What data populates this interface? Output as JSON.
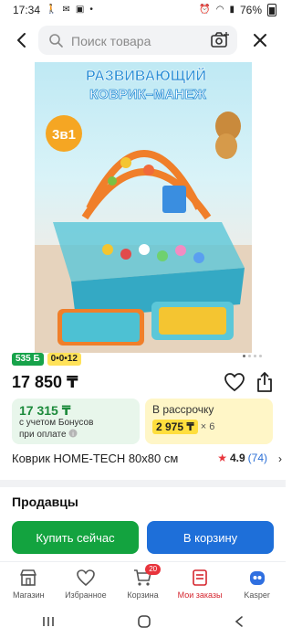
{
  "status_bar": {
    "time": "17:34",
    "battery": "76%"
  },
  "search": {
    "placeholder": "Поиск товара"
  },
  "product": {
    "image_title_line1": "РАЗВИВАЮЩИЙ",
    "image_title_line2": "КОВРИК–МАНЕЖ",
    "image_badge": "3в1",
    "bonus_badge": "535 Б",
    "installment_badge": "0•0•12",
    "price": "17 850 ₸",
    "name": "Коврик HOME-TECH 80x80 см",
    "rating": "4.9",
    "reviews": "(74)"
  },
  "bonus_card": {
    "price": "17 315 ₸",
    "note_line1": "с учетом Бонусов",
    "note_line2": "при оплате"
  },
  "installment_card": {
    "title": "В рассрочку",
    "amount": "2 975 ₸",
    "multiplier": "× 6"
  },
  "sellers": {
    "title": "Продавцы"
  },
  "actions": {
    "buy_now": "Купить сейчас",
    "to_cart": "В корзину"
  },
  "bottom_nav": {
    "items": [
      {
        "label": "Магазин",
        "icon": "shop-icon"
      },
      {
        "label": "Избранное",
        "icon": "heart-icon"
      },
      {
        "label": "Корзина",
        "icon": "cart-icon",
        "badge": "20"
      },
      {
        "label": "Мои заказы",
        "icon": "orders-icon",
        "active": true
      },
      {
        "label": "Kasper",
        "icon": "kasper-icon"
      }
    ]
  },
  "colors": {
    "accent_green": "#13a33f",
    "accent_blue": "#1e6fd9",
    "active_red": "#d5262f"
  }
}
